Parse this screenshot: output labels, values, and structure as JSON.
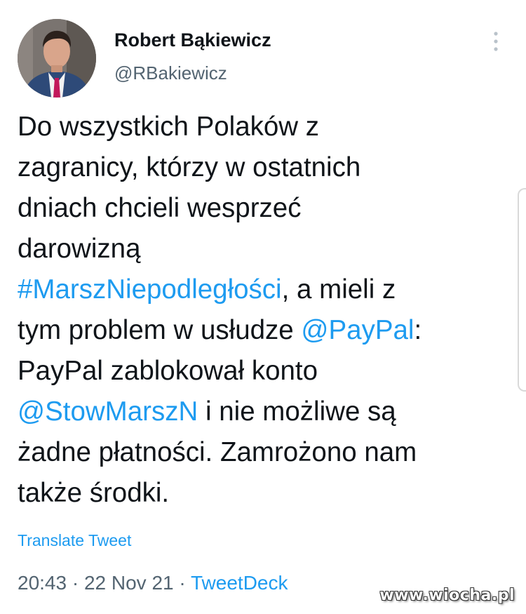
{
  "author": {
    "name": "Robert Bąkiewicz",
    "handle": "@RBakiewicz",
    "avatar_icon": "profile-photo"
  },
  "menu": {
    "icon": "more-vertical-icon"
  },
  "tweet": {
    "lines": [
      [
        {
          "t": "Do wszystkich Polaków z",
          "link": false
        }
      ],
      [
        {
          "t": "zagranicy, którzy w ostatnich",
          "link": false
        }
      ],
      [
        {
          "t": "dniach chcieli wesprzeć",
          "link": false
        }
      ],
      [
        {
          "t": "darowizną",
          "link": false
        }
      ],
      [
        {
          "t": "#MarszNiepodległości",
          "link": true
        },
        {
          "t": ", a mieli z",
          "link": false
        }
      ],
      [
        {
          "t": "tym problem w usłudze ",
          "link": false
        },
        {
          "t": "@PayPal",
          "link": true
        },
        {
          "t": ":",
          "link": false
        }
      ],
      [
        {
          "t": "PayPal zablokował konto",
          "link": false
        }
      ],
      [
        {
          "t": "@StowMarszN",
          "link": true
        },
        {
          "t": " i nie możliwe są",
          "link": false
        }
      ],
      [
        {
          "t": "żadne płatności. Zamrożono nam",
          "link": false
        }
      ],
      [
        {
          "t": "także środki.",
          "link": false
        }
      ]
    ],
    "translate_label": "Translate Tweet",
    "time": "20:43",
    "separator": " · ",
    "date": "22 Nov 21",
    "source": "TweetDeck"
  },
  "watermark": "www.wiocha.pl",
  "colors": {
    "link": "#1d9bf0",
    "text": "#0f1419",
    "secondary": "#536471"
  }
}
